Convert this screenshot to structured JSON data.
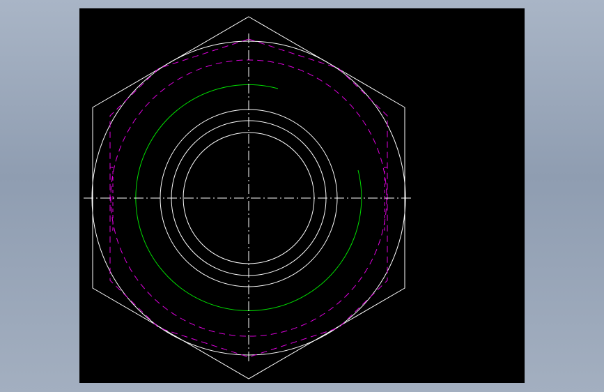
{
  "drawing": {
    "type": "hex-nut-top-view",
    "colors": {
      "background": "#000000",
      "outline": "#ffffff",
      "thread": "#00e000",
      "hidden": "#e000e0",
      "centerline": "#ffffff"
    },
    "line_styles": {
      "centerline": "dash-dot",
      "hidden": "dashed",
      "thread": "partial-arc"
    }
  }
}
